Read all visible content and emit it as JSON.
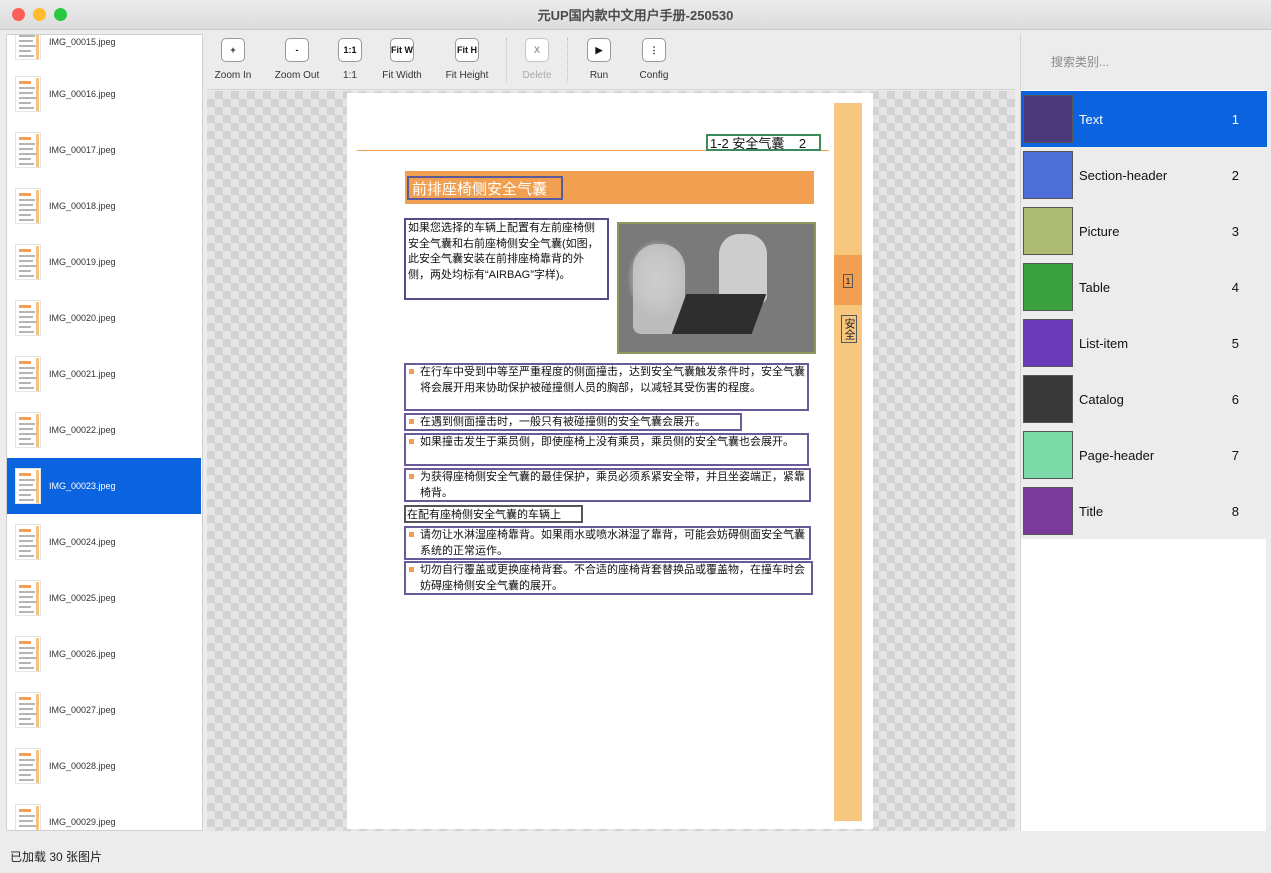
{
  "window": {
    "title": "元UP国内款中文用户手册-250530",
    "traffic_colors": [
      "#fe5f57",
      "#febc2e",
      "#28c840"
    ]
  },
  "files": [
    {
      "name": "IMG_00015.jpeg"
    },
    {
      "name": "IMG_00016.jpeg"
    },
    {
      "name": "IMG_00017.jpeg"
    },
    {
      "name": "IMG_00018.jpeg"
    },
    {
      "name": "IMG_00019.jpeg"
    },
    {
      "name": "IMG_00020.jpeg"
    },
    {
      "name": "IMG_00021.jpeg"
    },
    {
      "name": "IMG_00022.jpeg"
    },
    {
      "name": "IMG_00023.jpeg",
      "selected": true
    },
    {
      "name": "IMG_00024.jpeg"
    },
    {
      "name": "IMG_00025.jpeg"
    },
    {
      "name": "IMG_00026.jpeg"
    },
    {
      "name": "IMG_00027.jpeg"
    },
    {
      "name": "IMG_00028.jpeg"
    },
    {
      "name": "IMG_00029.jpeg"
    }
  ],
  "toolbar": {
    "zoom_in": {
      "icon": "+",
      "label": "Zoom In"
    },
    "zoom_out": {
      "icon": "-",
      "label": "Zoom Out"
    },
    "one_to_one": {
      "icon": "1:1",
      "label": "1:1"
    },
    "fit_width": {
      "icon": "Fit W",
      "label": "Fit Width"
    },
    "fit_height": {
      "icon": "Fit H",
      "label": "Fit Height"
    },
    "delete": {
      "icon": "X",
      "label": "Delete"
    },
    "run": {
      "icon": "▶",
      "label": "Run"
    },
    "config": {
      "icon": "⋮",
      "label": "Config"
    }
  },
  "document": {
    "page_header": "1-2 安全气囊    2",
    "section_header": "前排座椅侧安全气囊",
    "side_mark_1": "1",
    "side_mark_2": "安全",
    "intro_text": "如果您选择的车辆上配置有左前座椅侧安全气囊和右前座椅侧安全气囊(如图，此安全气囊安装在前排座椅靠背的外侧，两处均标有“AIRBAG”字样)。",
    "list_items": [
      "在行车中受到中等至严重程度的侧面撞击，达到安全气囊触发条件时，安全气囊将会展开用来协助保护被碰撞侧人员的胸部，以减轻其受伤害的程度。",
      "在遇到侧面撞击时，一般只有被碰撞侧的安全气囊会展开。",
      "如果撞击发生于乘员侧，即使座椅上没有乘员，乘员侧的安全气囊也会展开。",
      "为获得座椅侧安全气囊的最佳保护，乘员必须系紧安全带，并且坐姿端正，紧靠椅背。"
    ],
    "subtitle": "在配有座椅侧安全气囊的车辆上",
    "list_items_2": [
      "请勿让水淋湿座椅靠背。如果雨水或喷水淋湿了靠背，可能会妨碍侧面安全气囊系统的正常运作。",
      "切勿自行覆盖或更换座椅背套。不合适的座椅背套替换品或覆盖物，在撞车时会妨碍座椅侧安全气囊的展开。"
    ]
  },
  "categories_panel": {
    "search_placeholder": "搜索类别...",
    "items": [
      {
        "name": "Text",
        "num": "1",
        "color": "#4a3a7a",
        "selected": true
      },
      {
        "name": "Section-header",
        "num": "2",
        "color": "#4f6fd8"
      },
      {
        "name": "Picture",
        "num": "3",
        "color": "#aebb72"
      },
      {
        "name": "Table",
        "num": "4",
        "color": "#3aa040"
      },
      {
        "name": "List-item",
        "num": "5",
        "color": "#6a3ab8"
      },
      {
        "name": "Catalog",
        "num": "6",
        "color": "#383838"
      },
      {
        "name": "Page-header",
        "num": "7",
        "color": "#7ddbaa"
      },
      {
        "name": "Title",
        "num": "8",
        "color": "#7a3a9a"
      }
    ]
  },
  "status": {
    "text": "已加载 30 张图片"
  }
}
